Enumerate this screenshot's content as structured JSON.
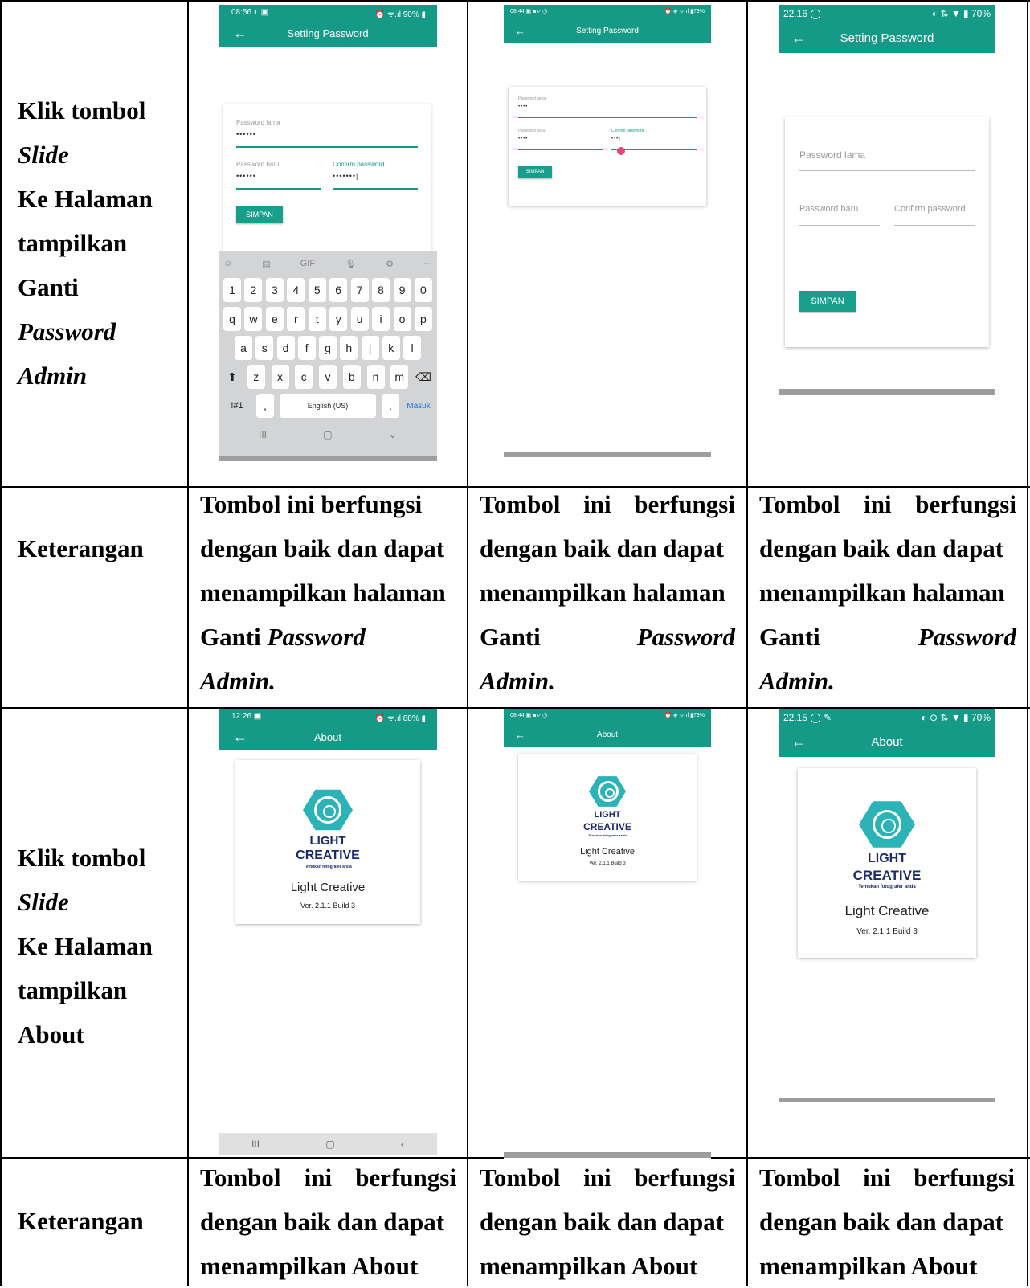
{
  "row1": {
    "label": {
      "l1": "Klik tombol",
      "l2": "Slide",
      "l3": "Ke Halaman",
      "l4": "tampilkan",
      "l5": "Ganti",
      "l6": "Password",
      "l7": "Admin"
    },
    "screens": [
      {
        "status_left": "08:56 ◐ ▣",
        "status_right": "⏰ ᯤ.ıl 90% ▮",
        "title": "Setting Password",
        "old_label": "Password lama",
        "old_value": "••••••",
        "new_label": "Password baru",
        "new_value": "••••••",
        "confirm_label": "Confirm password",
        "confirm_value": "•••••••|",
        "button": "SIMPAN",
        "keyboard": {
          "row0": [
            "☺",
            "▤",
            "GIF",
            "🎙",
            "⚙",
            "···"
          ],
          "digits": [
            "1",
            "2",
            "3",
            "4",
            "5",
            "6",
            "7",
            "8",
            "9",
            "0"
          ],
          "row1": [
            "q",
            "w",
            "e",
            "r",
            "t",
            "y",
            "u",
            "i",
            "o",
            "p"
          ],
          "row2": [
            "a",
            "s",
            "d",
            "f",
            "g",
            "h",
            "j",
            "k",
            "l"
          ],
          "row3": [
            "⬆",
            "z",
            "x",
            "c",
            "v",
            "b",
            "n",
            "m",
            "⌫"
          ],
          "sym": "!#1",
          "comma": ",",
          "space": "English (US)",
          "period": ".",
          "enter": "Masuk",
          "nav": [
            "III",
            "▢",
            "⌄"
          ]
        }
      },
      {
        "status_left": "08.44 ▣ ◙ ⩗ ◷ ·",
        "status_right": "⏰ ◈ ᯤ.ıl ▮79%",
        "title": "Setting Password",
        "old_label": "Password lama",
        "old_value": "••••",
        "new_label": "Password baru",
        "new_value": "••••",
        "confirm_label": "Confirm password",
        "confirm_value": "•••|",
        "button": "SIMPAN"
      },
      {
        "status_left": "22.16 ◯",
        "status_right": "◐ ⇅ ▼ ▮ 70%",
        "title": "Setting Password",
        "old_label": "Password lama",
        "new_label": "Password baru",
        "confirm_label": "Confirm password",
        "button": "SIMPAN"
      }
    ]
  },
  "row2": {
    "label": "Keterangan",
    "descs": [
      {
        "l1": "Tombol ini berfungsi",
        "l2": "dengan baik dan dapat",
        "l3": "menampilkan halaman",
        "l4a": "Ganti",
        "l4b": "Password",
        "l5": "Admin."
      },
      {
        "l1a": "Tombol",
        "l1b": "ini",
        "l1c": "berfungsi",
        "l2": "dengan baik dan dapat",
        "l3": "menampilkan halaman",
        "l4a": "Ganti",
        "l4b": "Password",
        "l5": "Admin."
      },
      {
        "l1a": "Tombol",
        "l1b": "ini",
        "l1c": "berfungsi",
        "l2": "dengan baik dan dapat",
        "l3": "menampilkan halaman",
        "l4a": "Ganti",
        "l4b": "Password",
        "l5": "Admin."
      }
    ]
  },
  "row3": {
    "label": {
      "l1": "Klik tombol",
      "l2": "Slide",
      "l3": "Ke Halaman",
      "l4": "tampilkan",
      "l5": "About"
    },
    "screens": [
      {
        "status_left": "12:26 ▣",
        "status_right": "⏰ ᯤ.ıl 88% ▮",
        "title": "About",
        "logo1": "LIGHT",
        "logo2": "CREATIVE",
        "logo3": "Temukan fotografer anda",
        "name": "Light Creative",
        "version": "Ver. 2.1.1 Build 3",
        "nav": [
          "III",
          "▢",
          "‹"
        ]
      },
      {
        "status_left": "08.44 ▣ ◙ ⩗ ◷ ·",
        "status_right": "⏰ ◈ ᯤ.ıl ▮79%",
        "title": "About",
        "logo1": "LIGHT",
        "logo2": "CREATIVE",
        "logo3": "Temukan fotografer anda",
        "name": "Light Creative",
        "version": "Ver. 2.1.1 Build 3"
      },
      {
        "status_left": "22.15 ◯ ✎",
        "status_right": "◐ ⊙ ⇅ ▼ ▮ 70%",
        "title": "About",
        "logo1": "LIGHT",
        "logo2": "CREATIVE",
        "logo3": "Temukan fotografer anda",
        "name": "Light Creative",
        "version": "Ver. 2.1.1 Build 3"
      }
    ]
  },
  "row4": {
    "label": "Keterangan",
    "descs": [
      {
        "l1a": "Tombol",
        "l1b": "ini",
        "l1c": "berfungsi",
        "l2": "dengan baik dan dapat",
        "l3": "menampilkan About"
      },
      {
        "l1a": "Tombol",
        "l1b": "ini",
        "l1c": "berfungsi",
        "l2": "dengan baik dan dapat",
        "l3": "menampilkan About"
      },
      {
        "l1a": "Tombol",
        "l1b": "ini",
        "l1c": "berfungsi",
        "l2": "dengan baik dan dapat",
        "l3": "menampilkan About"
      }
    ]
  },
  "colors": {
    "accent": "#149a87",
    "logo": "#2bb3b6",
    "logo_text": "#1d2a6b"
  }
}
